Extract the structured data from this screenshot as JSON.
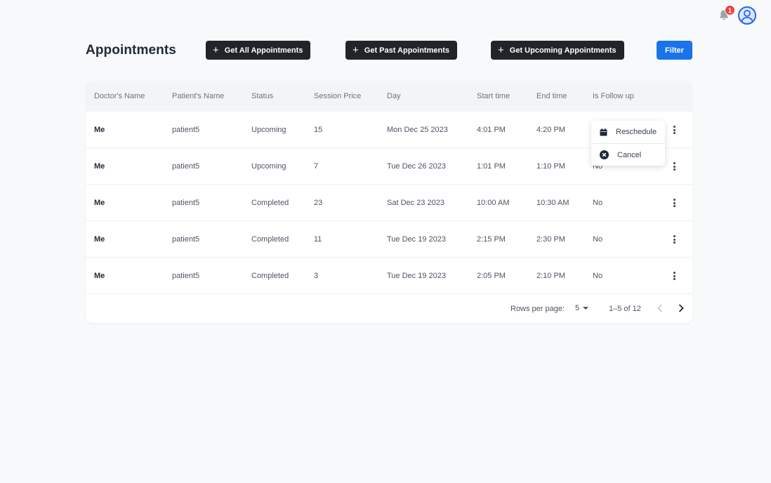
{
  "topbar": {
    "notification_count": "1"
  },
  "header": {
    "title": "Appointments",
    "btn_all": "Get All Appointments",
    "btn_past": "Get Past Appointments",
    "btn_upcoming": "Get Upcoming Appointments",
    "btn_filter": "Filter"
  },
  "table": {
    "columns": [
      "Doctor's Name",
      "Patient's Name",
      "Status",
      "Session Price",
      "Day",
      "Start time",
      "End time",
      "Is Follow up"
    ],
    "rows": [
      [
        "Me",
        "patient5",
        "Upcoming",
        "15",
        "Mon Dec 25 2023",
        "4:01 PM",
        "4:20 PM",
        ""
      ],
      [
        "Me",
        "patient5",
        "Upcoming",
        "7",
        "Tue Dec 26 2023",
        "1:01 PM",
        "1:10 PM",
        "No"
      ],
      [
        "Me",
        "patient5",
        "Completed",
        "23",
        "Sat Dec 23 2023",
        "10:00 AM",
        "10:30 AM",
        "No"
      ],
      [
        "Me",
        "patient5",
        "Completed",
        "11",
        "Tue Dec 19 2023",
        "2:15 PM",
        "2:30 PM",
        "No"
      ],
      [
        "Me",
        "patient5",
        "Completed",
        "3",
        "Tue Dec 19 2023",
        "2:05 PM",
        "2:10 PM",
        "No"
      ]
    ]
  },
  "pagination": {
    "rows_per_page_label": "Rows per page:",
    "rows_per_page_value": "5",
    "range": "1–5 of 12"
  },
  "menu": {
    "reschedule": "Reschedule",
    "cancel": "Cancel"
  }
}
